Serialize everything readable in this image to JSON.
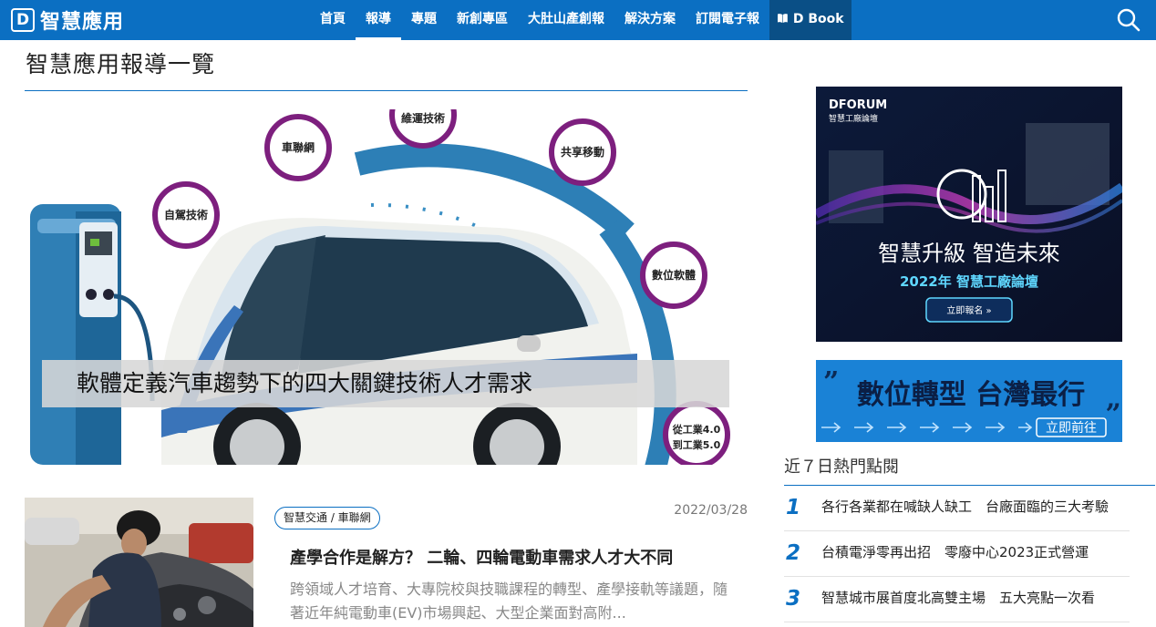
{
  "nav": {
    "logo_mark": "D",
    "logo_text": "智慧應用",
    "items": [
      {
        "label": "首頁"
      },
      {
        "label": "報導"
      },
      {
        "label": "專題"
      },
      {
        "label": "新創專區"
      },
      {
        "label": "大肚山產創報"
      },
      {
        "label": "解決方案"
      },
      {
        "label": "訂閱電子報"
      },
      {
        "label": "D Book"
      }
    ],
    "active_item": "報導",
    "dbook_icon": "book-icon",
    "search_icon": "search-icon"
  },
  "main": {
    "page_title": "智慧應用報導一覽",
    "hero": {
      "caption": "軟體定義汽車趨勢下的四大關鍵技術人才需求",
      "badges": [
        "自駕技術",
        "車聯網",
        "維運技術",
        "共享移動",
        "數位軟體"
      ],
      "corner_text_1": "從工業4.0",
      "corner_text_2": "到工業5.0"
    },
    "article": {
      "tag": "智慧交通 / 車聯網",
      "date": "2022/03/28",
      "title": "產學合作是解方？ 二輪、四輪電動車需求人才大不同",
      "excerpt": "跨領域人才培育、大專院校與技職課程的轉型、產學接軌等議題，隨著近年純電動車(EV)市場興起、大型企業面對高附..."
    }
  },
  "sidebar": {
    "ad1": {
      "brand": "DFORUM",
      "brand_sub": "智慧工廠論壇",
      "headline": "智慧升級 智造未來",
      "subline": "2022年 智慧工廠論壇",
      "button": "立即報名 »"
    },
    "ad2": {
      "headline": "數位轉型 台灣最行",
      "button": "立即前往"
    },
    "popular": {
      "heading": "近７日熱門點閱",
      "items": [
        {
          "num": "1",
          "text": "各行各業都在喊缺人缺工　台廠面臨的三大考驗"
        },
        {
          "num": "2",
          "text": "台積電淨零再出招　零廢中心2023正式營運"
        },
        {
          "num": "3",
          "text": "智慧城市展首度北高雙主場　五大亮點一次看"
        }
      ]
    }
  },
  "colors": {
    "brand_blue": "#0b6fc2",
    "nav_dark": "#0a4f86",
    "accent_purple": "#7d1f7e"
  }
}
